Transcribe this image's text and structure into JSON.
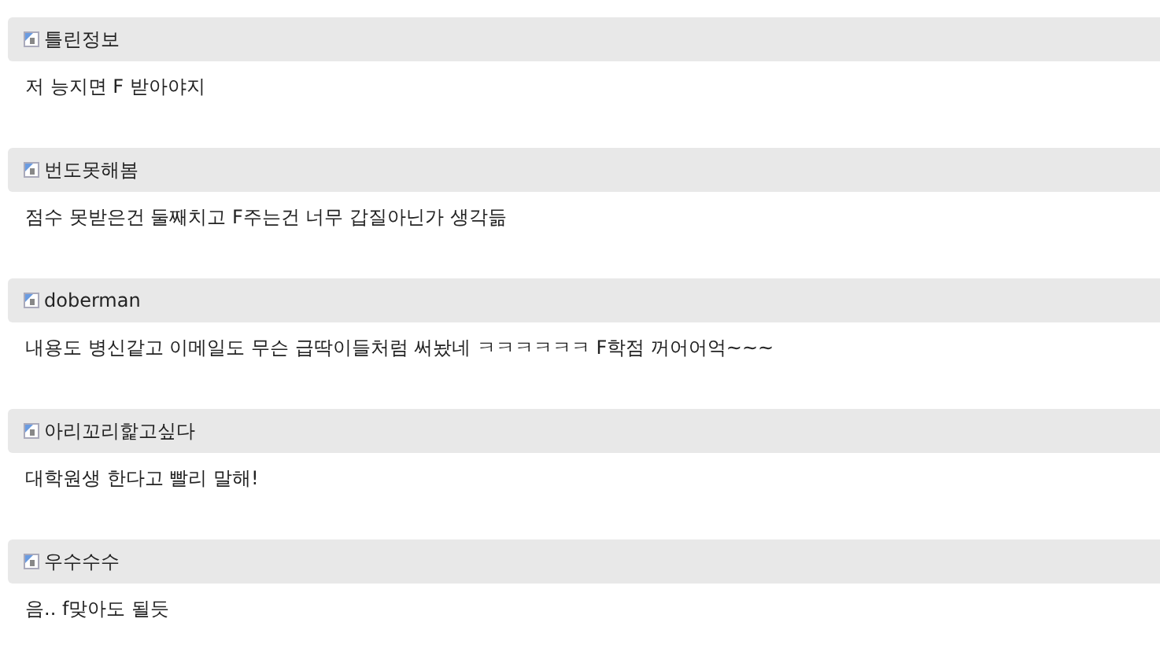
{
  "comments": [
    {
      "author": "틀린정보",
      "text": "저 능지면 F 받아야지"
    },
    {
      "author": "번도못해봄",
      "text": "점수 못받은건 둘째치고 F주는건 너무 갑질아닌가 생각듦"
    },
    {
      "author": "doberman",
      "text": "내용도 병신같고 이메일도 무슨 급딱이들처럼 써놨네 ㅋㅋㅋㅋㅋㅋ F학점 꺼어어억~~~"
    },
    {
      "author": "아리꼬리핥고싶다",
      "text": "대학원생 한다고 빨리 말해!"
    },
    {
      "author": "우수수수",
      "text": "음.. f맞아도 될듯"
    }
  ]
}
